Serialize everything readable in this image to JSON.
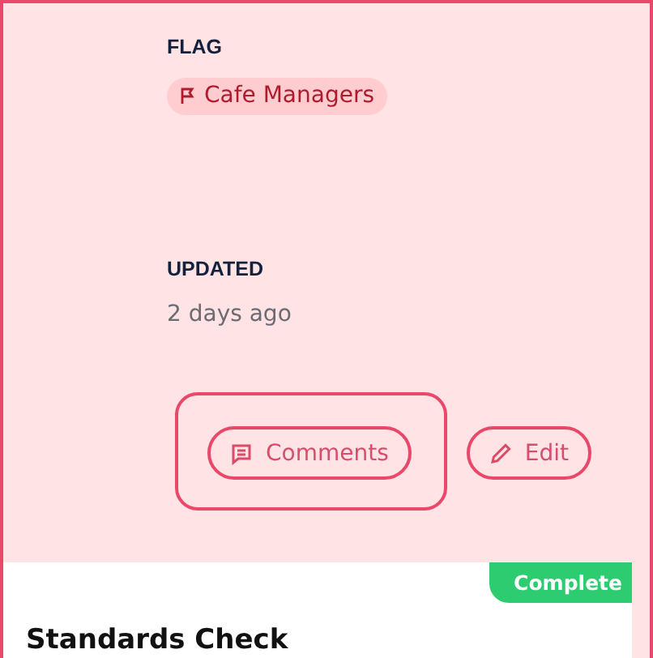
{
  "fields": [
    {
      "label": "FLAG",
      "kind": "tag",
      "value": "Cafe Managers"
    },
    {
      "label": "UPDATED",
      "kind": "text",
      "value": "2 days ago"
    }
  ],
  "actions": [
    {
      "label": "Comments",
      "kind": "comment",
      "focused": true
    },
    {
      "label": "Edit",
      "kind": "edit",
      "focused": false
    }
  ],
  "card": {
    "status": "Complete",
    "title": "Standards Check"
  }
}
